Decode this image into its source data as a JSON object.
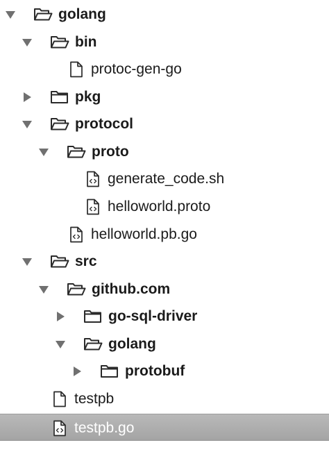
{
  "tree": {
    "items": [
      {
        "label": "golang",
        "kind": "folder",
        "state": "expanded",
        "bold": true
      },
      {
        "label": "bin",
        "kind": "folder",
        "state": "expanded",
        "bold": true
      },
      {
        "label": "protoc-gen-go",
        "kind": "file",
        "state": "none",
        "bold": false
      },
      {
        "label": "pkg",
        "kind": "folder",
        "state": "collapsed",
        "bold": true
      },
      {
        "label": "protocol",
        "kind": "folder",
        "state": "expanded",
        "bold": true
      },
      {
        "label": "proto",
        "kind": "folder",
        "state": "expanded",
        "bold": true
      },
      {
        "label": "generate_code.sh",
        "kind": "code-file",
        "state": "none",
        "bold": false
      },
      {
        "label": "helloworld.proto",
        "kind": "code-file",
        "state": "none",
        "bold": false
      },
      {
        "label": "helloworld.pb.go",
        "kind": "code-file",
        "state": "none",
        "bold": false
      },
      {
        "label": "src",
        "kind": "folder",
        "state": "expanded",
        "bold": true
      },
      {
        "label": "github.com",
        "kind": "folder",
        "state": "expanded",
        "bold": true
      },
      {
        "label": "go-sql-driver",
        "kind": "folder",
        "state": "collapsed",
        "bold": true
      },
      {
        "label": "golang",
        "kind": "folder",
        "state": "expanded",
        "bold": true
      },
      {
        "label": "protobuf",
        "kind": "folder",
        "state": "collapsed",
        "bold": true
      },
      {
        "label": "testpb",
        "kind": "file",
        "state": "none",
        "bold": false
      },
      {
        "label": "testpb.go",
        "kind": "code-file",
        "state": "none",
        "bold": false,
        "selected": true
      }
    ]
  },
  "colors": {
    "selection": "#a8a8a8",
    "text": "#1b1b1b",
    "selected_text": "#ffffff",
    "icon_stroke": "#2a2a2a",
    "triangle": "#707070"
  }
}
